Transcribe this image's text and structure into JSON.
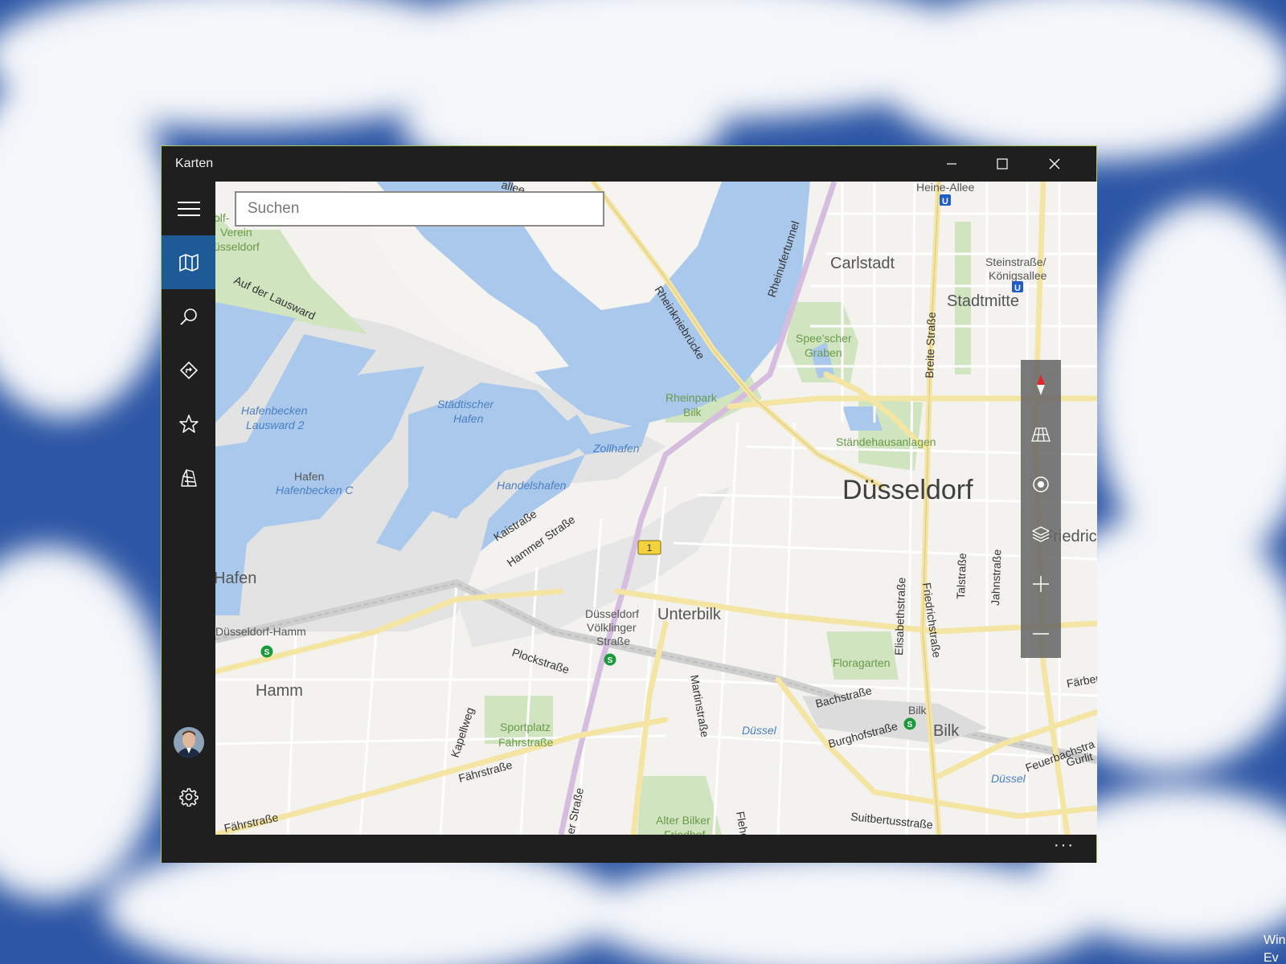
{
  "window": {
    "title": "Karten"
  },
  "search": {
    "placeholder": "Suchen",
    "value": ""
  },
  "sidebar": {
    "items": [
      {
        "id": "menu",
        "icon": "hamburger-icon"
      },
      {
        "id": "map",
        "icon": "map-icon",
        "active": true
      },
      {
        "id": "search",
        "icon": "search-icon"
      },
      {
        "id": "directions",
        "icon": "directions-icon"
      },
      {
        "id": "favorites",
        "icon": "star-icon"
      },
      {
        "id": "3d-cities",
        "icon": "3d-city-icon"
      }
    ],
    "bottom": [
      {
        "id": "account",
        "icon": "avatar"
      },
      {
        "id": "settings",
        "icon": "gear-icon"
      }
    ]
  },
  "map_controls": [
    {
      "id": "compass",
      "icon": "compass-icon"
    },
    {
      "id": "tilt",
      "icon": "tilt-grid-icon"
    },
    {
      "id": "location",
      "icon": "location-icon"
    },
    {
      "id": "layers",
      "icon": "layers-icon"
    },
    {
      "id": "zoom-in",
      "icon": "plus-icon"
    },
    {
      "id": "zoom-out",
      "icon": "minus-icon"
    }
  ],
  "map": {
    "district_labels": {
      "duesseldorf": "Düsseldorf",
      "carlstadt": "Carlstadt",
      "stadtmitte": "Stadtmitte",
      "unterbilk": "Unterbilk",
      "hamm": "Hamm",
      "bilk": "Bilk",
      "hafen": "Hafen",
      "friedric": "Friedric"
    },
    "water_labels": {
      "hafenbecken_lausward_1": "Hafenbecken",
      "hafenbecken_lausward_2": "Lausward 2",
      "staedtischer_1": "Städtischer",
      "staedtischer_2": "Hafen",
      "zollhafen": "Zollhafen",
      "handelshafen": "Handelshafen",
      "hafenbecken_c": "Hafenbecken C",
      "duessel_1": "Düssel",
      "duessel_2": "Düssel"
    },
    "green_labels": {
      "spee_1": "Spee'scher",
      "spee_2": "Graben",
      "rheinpark_1": "Rheinpark",
      "rheinpark_2": "Bilk",
      "staendehaus": "Ständehausanlagen",
      "floragarten": "Floragarten",
      "sportplatz_1": "Sportplatz",
      "sportplatz_2": "Fährstraße",
      "alter_bilker_1": "Alter Bilker",
      "alter_bilker_2": "Friedhof",
      "golf_1": "olf-",
      "golf_2": "Verein",
      "golf_3": "üsseldorf"
    },
    "street_labels": {
      "allee_top": "allee",
      "auf_der_lausward": "Auf der Lausward",
      "rheinkniebruecke": "Rheinkniebrücke",
      "rheinufertunnel": "Rheinufertunnel",
      "breite_strasse": "Breite Straße",
      "kaistrasse": "Kaistraße",
      "hammer_strasse": "Hammer Straße",
      "plockstrasse": "Plockstraße",
      "kapellweg": "Kapellweg",
      "faehrstrasse_1": "Fährstraße",
      "faehrstrasse_2": "Fährstraße",
      "voelklinger_str": "er Straße",
      "martinstrasse": "Martinstraße",
      "elisabethstrasse": "Elisabethstraße",
      "friedrichstrasse": "Friedrichstraße",
      "talstrasse": "Talstraße",
      "jahnstrasse": "Jahnstraße",
      "bachstrasse": "Bachstraße",
      "burghofstrasse": "Burghofstraße",
      "suitbertusstrasse": "Suitbertusstraße",
      "feuerbachstr": "Feuerbachstra",
      "gurlit": "Gurlit",
      "faerber": "Färber",
      "flehe": "Flehe"
    },
    "transit_labels": {
      "heine_allee": "Heine-Allee",
      "steinstrasse_1": "Steinstraße/",
      "steinstrasse_2": "Königsallee",
      "voelklinger_1": "Düsseldorf",
      "voelklinger_2": "Völklinger",
      "voelklinger_3": "Straße",
      "hamm_station": "Düsseldorf-Hamm",
      "bilk_station": "Bilk"
    },
    "road_shield": "1",
    "u_badge": "U",
    "s_badge": "S"
  },
  "bottombar": {
    "more_label": "···"
  },
  "desktop": {
    "corner_1": "Win",
    "corner_2": "Ev"
  },
  "colors": {
    "titlebar": "#1f1f1f",
    "active_nav": "#1e5a96",
    "water": "#a9c8ec",
    "park": "#cfe4bf",
    "major_road": "#f4e5a5",
    "tram": "#d6bde0",
    "map_bg": "#f3f2ef",
    "window_border": "#a9c95e"
  }
}
